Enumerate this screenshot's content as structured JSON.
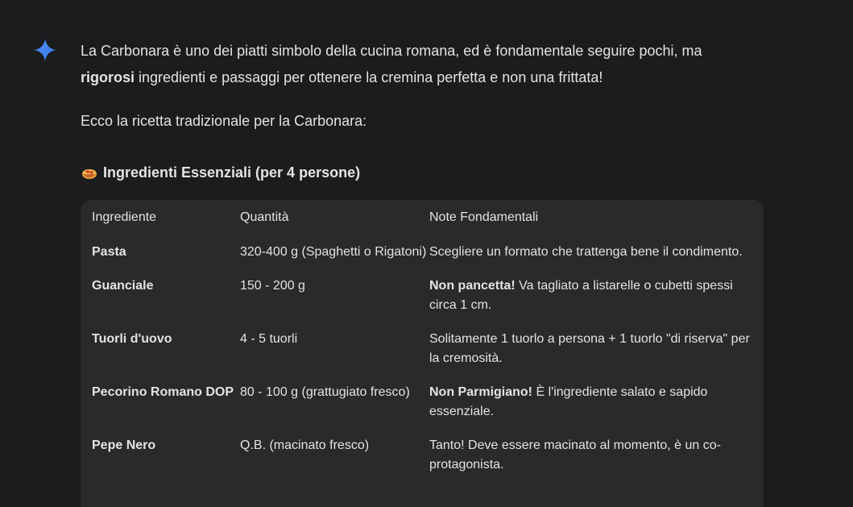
{
  "intro": {
    "line1": "La Carbonara è uno dei piatti simbolo della cucina romana, ed è fondamentale seguire pochi, ma",
    "bold_word": "rigorosi",
    "line2_rest": " ingredienti e passaggi per ottenere la cremina perfetta e non una frittata!"
  },
  "recipe_intro": "Ecco la ricetta tradizionale per la Carbonara:",
  "section": {
    "icon": "pasta-bowl-emoji",
    "title": "Ingredienti Essenziali (per 4 persone)"
  },
  "table": {
    "headers": [
      "Ingrediente",
      "Quantità",
      "Note Fondamentali"
    ],
    "rows": [
      {
        "ingredient": "Pasta",
        "quantity": "320-400 g (Spaghetti o Rigatoni)",
        "note_bold": "",
        "note": "Scegliere un formato che trattenga bene il condimento."
      },
      {
        "ingredient": "Guanciale",
        "quantity": "150 - 200 g",
        "note_bold": "Non pancetta!",
        "note": " Va tagliato a listarelle o cubetti spessi circa 1 cm."
      },
      {
        "ingredient": "Tuorli d'uovo",
        "quantity": "4 - 5 tuorli",
        "note_bold": "",
        "note": "Solitamente 1 tuorlo a persona + 1 tuorlo \"di riserva\" per la cremosità."
      },
      {
        "ingredient": "Pecorino Romano DOP",
        "quantity": "80 - 100 g (grattugiato fresco)",
        "note_bold": "Non Parmigiano!",
        "note": " È l'ingrediente salato e sapido essenziale."
      },
      {
        "ingredient": "Pepe Nero",
        "quantity": "Q.B. (macinato fresco)",
        "note_bold": "",
        "note": "Tanto! Deve essere macinato al momento, è un co-protagonista."
      }
    ]
  },
  "colors": {
    "background": "#1b1c1d",
    "table_background": "#282a2c",
    "text": "#e3e3e3",
    "sparkle_gradient_start": "#4285f4",
    "sparkle_gradient_end": "#9b72cb"
  }
}
